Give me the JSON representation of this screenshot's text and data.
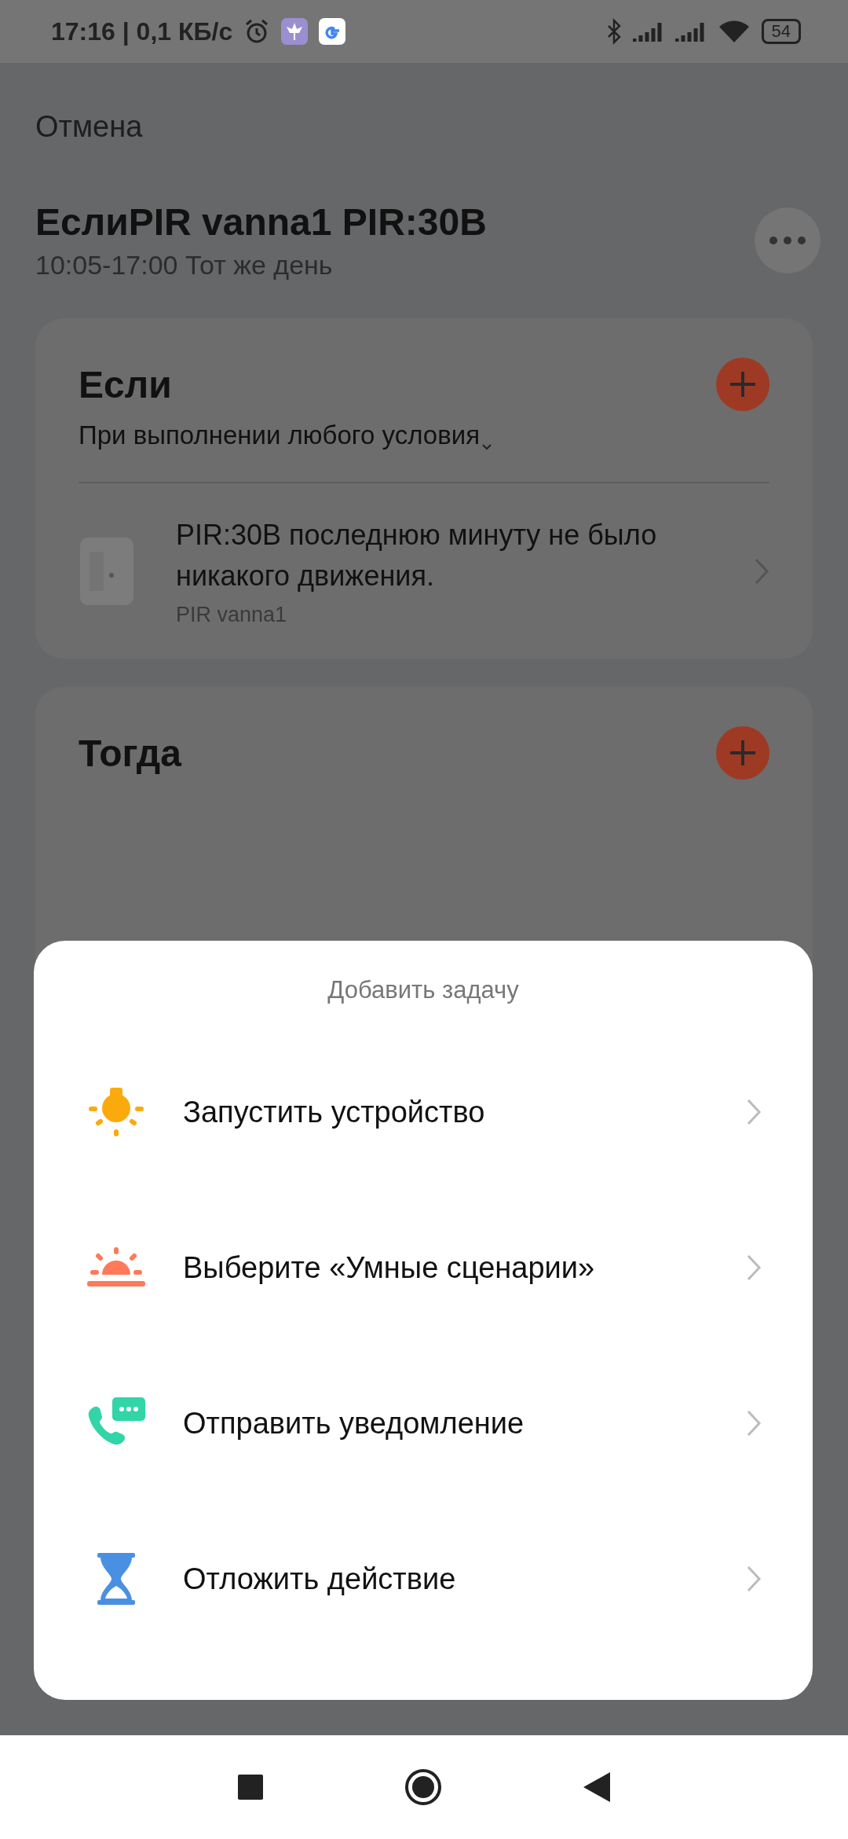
{
  "status_bar": {
    "time_speed": "17:16 | 0,1 КБ/с",
    "battery": "54"
  },
  "cancel": "Отмена",
  "title": "ЕслиPIR vanna1 PIR:30B",
  "subtitle": "10:05-17:00 Тот же день",
  "if_card": {
    "title": "Если",
    "mode": "При выполнении любого условия",
    "conditions": [
      {
        "text": "PIR:30B последнюю минуту не было никакого движения.",
        "device": "PIR vanna1"
      }
    ]
  },
  "then_card": {
    "title": "Тогда"
  },
  "sheet": {
    "title": "Добавить задачу",
    "items": [
      {
        "kind": "device",
        "label": "Запустить устройство"
      },
      {
        "kind": "scene",
        "label": "Выберите «Умные сценарии»"
      },
      {
        "kind": "notify",
        "label": "Отправить уведомление"
      },
      {
        "kind": "delay",
        "label": "Отложить действие"
      }
    ]
  }
}
